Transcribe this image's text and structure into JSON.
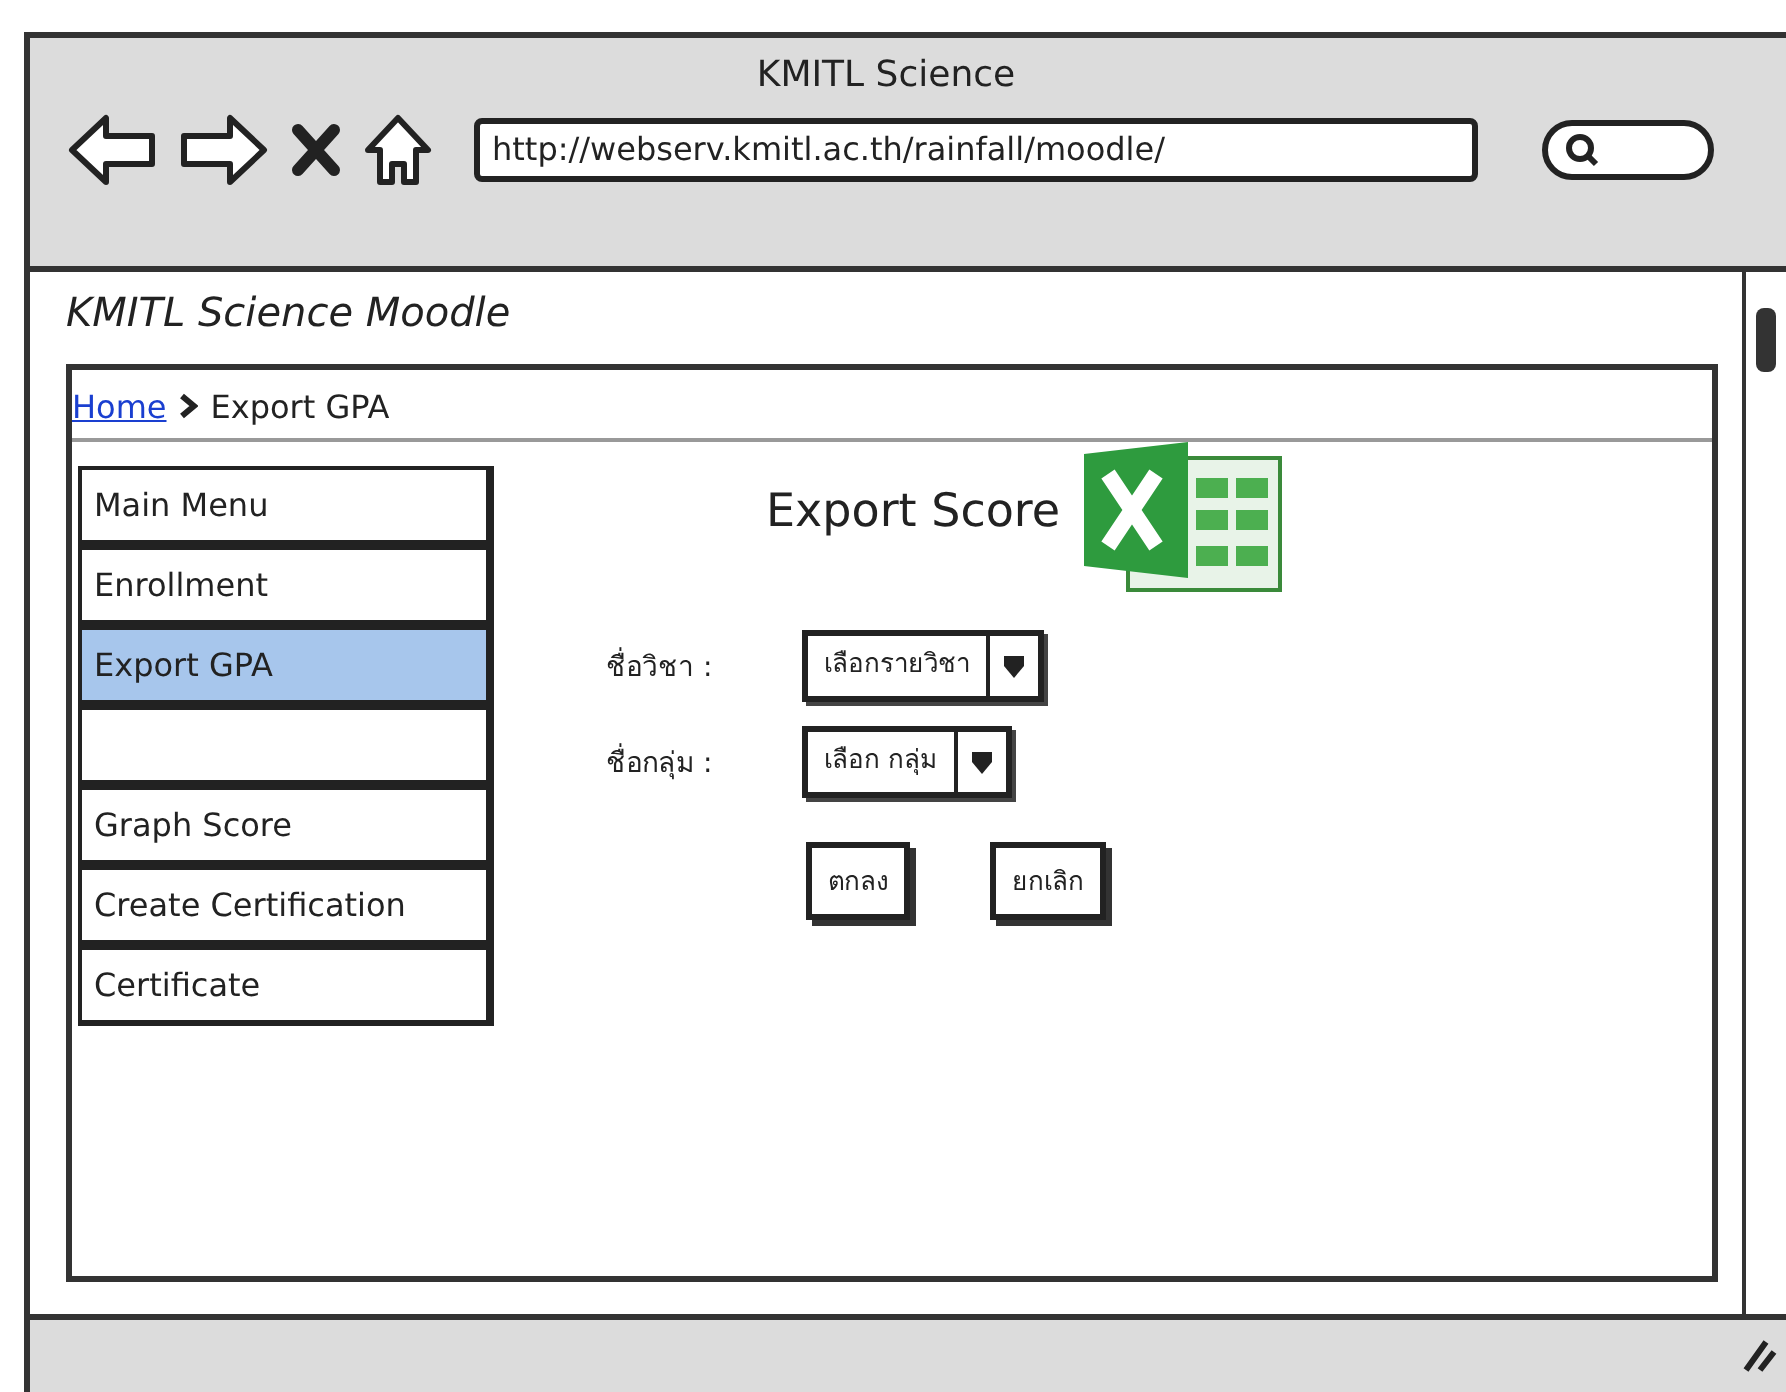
{
  "window": {
    "title": "KMITL Science"
  },
  "address_bar": {
    "value": "http://webserv.kmitl.ac.th/rainfall/moodle/"
  },
  "site_title": "KMITL Science Moodle",
  "breadcrumb": [
    {
      "label": "Home",
      "link": true
    },
    {
      "label": "Export GPA",
      "link": false
    }
  ],
  "menu": [
    {
      "kind": "item",
      "label": "Main Menu",
      "selected": false
    },
    {
      "kind": "item",
      "label": "Enrollment",
      "selected": false
    },
    {
      "kind": "item",
      "label": "Export GPA",
      "selected": true
    },
    {
      "kind": "blank",
      "selected": false
    },
    {
      "kind": "item",
      "label": "Graph Score",
      "selected": false
    },
    {
      "kind": "item",
      "label": "Create Certification",
      "selected": false
    },
    {
      "kind": "item",
      "label": "Certificate",
      "selected": false
    }
  ],
  "content": {
    "title": "Export Score",
    "fields": [
      {
        "label": "ชื่อวิชา :",
        "value": "เลือกรายวิชา"
      },
      {
        "label": "ชื่อกลุ่ม :",
        "value": "เลือก กลุ่ม"
      }
    ],
    "buttons": [
      "ตกลง",
      "ยกเลิก"
    ]
  }
}
